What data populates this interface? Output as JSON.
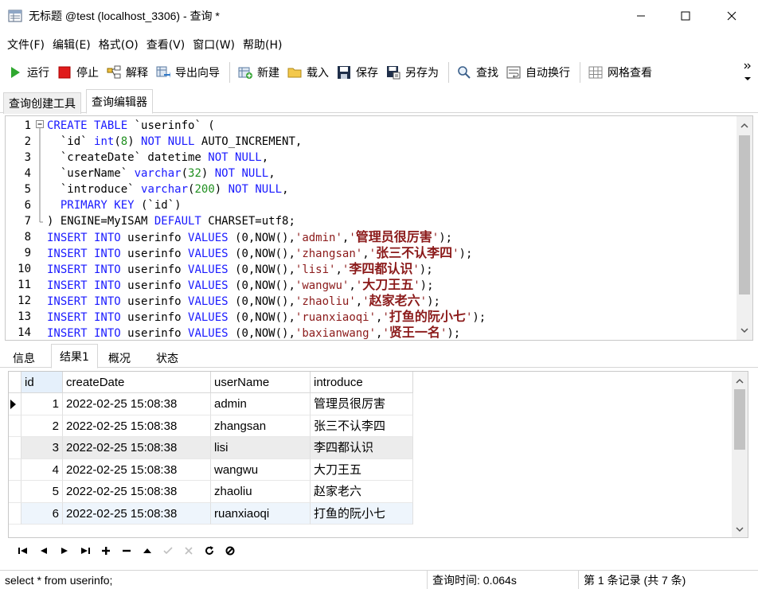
{
  "window": {
    "title": "无标题 @test (localhost_3306) - 查询 *"
  },
  "menu": [
    "文件(F)",
    "编辑(E)",
    "格式(O)",
    "查看(V)",
    "窗口(W)",
    "帮助(H)"
  ],
  "toolbar": {
    "run": "运行",
    "stop": "停止",
    "explain": "解释",
    "export_wizard": "导出向导",
    "new": "新建",
    "load": "载入",
    "save": "保存",
    "save_as": "另存为",
    "find": "查找",
    "word_wrap": "自动换行",
    "grid_view": "网格查看"
  },
  "editor_tabs": {
    "builder": "查询创建工具",
    "editor": "查询编辑器"
  },
  "code": {
    "line_numbers": [
      "1",
      "2",
      "3",
      "4",
      "5",
      "6",
      "7",
      "8",
      "9",
      "10",
      "11",
      "12",
      "13",
      "14"
    ],
    "lines": [
      [
        [
          "kw",
          "CREATE TABLE"
        ],
        [
          "pl",
          " `userinfo` ("
        ]
      ],
      [
        [
          "pl",
          "  `id` "
        ],
        [
          "kw",
          "int"
        ],
        [
          "pl",
          "("
        ],
        [
          "num",
          "8"
        ],
        [
          "pl",
          ") "
        ],
        [
          "kw",
          "NOT NULL"
        ],
        [
          "pl",
          " AUTO_INCREMENT,"
        ]
      ],
      [
        [
          "pl",
          "  `createDate` datetime "
        ],
        [
          "kw",
          "NOT NULL"
        ],
        [
          "pl",
          ","
        ]
      ],
      [
        [
          "pl",
          "  `userName` "
        ],
        [
          "kw",
          "varchar"
        ],
        [
          "pl",
          "("
        ],
        [
          "num",
          "32"
        ],
        [
          "pl",
          ") "
        ],
        [
          "kw",
          "NOT NULL"
        ],
        [
          "pl",
          ","
        ]
      ],
      [
        [
          "pl",
          "  `introduce` "
        ],
        [
          "kw",
          "varchar"
        ],
        [
          "pl",
          "("
        ],
        [
          "num",
          "200"
        ],
        [
          "pl",
          ") "
        ],
        [
          "kw",
          "NOT NULL"
        ],
        [
          "pl",
          ","
        ]
      ],
      [
        [
          "pl",
          "  "
        ],
        [
          "kw",
          "PRIMARY KEY"
        ],
        [
          "pl",
          " (`id`)"
        ]
      ],
      [
        [
          "pl",
          ") ENGINE=MyISAM "
        ],
        [
          "kw",
          "DEFAULT"
        ],
        [
          "pl",
          " CHARSET=utf8;"
        ]
      ],
      [
        [
          "kw",
          "INSERT INTO"
        ],
        [
          "pl",
          " userinfo "
        ],
        [
          "kw",
          "VALUES"
        ],
        [
          "pl",
          " (0,NOW(),"
        ],
        [
          "str",
          "'admin'"
        ],
        [
          "pl",
          ","
        ],
        [
          "str",
          "'"
        ],
        [
          "cn",
          "管理员很厉害"
        ],
        [
          "str",
          "'"
        ],
        [
          "pl",
          ");"
        ]
      ],
      [
        [
          "kw",
          "INSERT INTO"
        ],
        [
          "pl",
          " userinfo "
        ],
        [
          "kw",
          "VALUES"
        ],
        [
          "pl",
          " (0,NOW(),"
        ],
        [
          "str",
          "'zhangsan'"
        ],
        [
          "pl",
          ","
        ],
        [
          "str",
          "'"
        ],
        [
          "cn",
          "张三不认李四"
        ],
        [
          "str",
          "'"
        ],
        [
          "pl",
          ");"
        ]
      ],
      [
        [
          "kw",
          "INSERT INTO"
        ],
        [
          "pl",
          " userinfo "
        ],
        [
          "kw",
          "VALUES"
        ],
        [
          "pl",
          " (0,NOW(),"
        ],
        [
          "str",
          "'lisi'"
        ],
        [
          "pl",
          ","
        ],
        [
          "str",
          "'"
        ],
        [
          "cn",
          "李四都认识"
        ],
        [
          "str",
          "'"
        ],
        [
          "pl",
          ");"
        ]
      ],
      [
        [
          "kw",
          "INSERT INTO"
        ],
        [
          "pl",
          " userinfo "
        ],
        [
          "kw",
          "VALUES"
        ],
        [
          "pl",
          " (0,NOW(),"
        ],
        [
          "str",
          "'wangwu'"
        ],
        [
          "pl",
          ","
        ],
        [
          "str",
          "'"
        ],
        [
          "cn",
          "大刀王五"
        ],
        [
          "str",
          "'"
        ],
        [
          "pl",
          ");"
        ]
      ],
      [
        [
          "kw",
          "INSERT INTO"
        ],
        [
          "pl",
          " userinfo "
        ],
        [
          "kw",
          "VALUES"
        ],
        [
          "pl",
          " (0,NOW(),"
        ],
        [
          "str",
          "'zhaoliu'"
        ],
        [
          "pl",
          ","
        ],
        [
          "str",
          "'"
        ],
        [
          "cn",
          "赵家老六"
        ],
        [
          "str",
          "'"
        ],
        [
          "pl",
          ");"
        ]
      ],
      [
        [
          "kw",
          "INSERT INTO"
        ],
        [
          "pl",
          " userinfo "
        ],
        [
          "kw",
          "VALUES"
        ],
        [
          "pl",
          " (0,NOW(),"
        ],
        [
          "str",
          "'ruanxiaoqi'"
        ],
        [
          "pl",
          ","
        ],
        [
          "str",
          "'"
        ],
        [
          "cn",
          "打鱼的阮小七"
        ],
        [
          "str",
          "'"
        ],
        [
          "pl",
          ");"
        ]
      ],
      [
        [
          "kw",
          "INSERT INTO"
        ],
        [
          "pl",
          " userinfo "
        ],
        [
          "kw",
          "VALUES"
        ],
        [
          "pl",
          " (0,NOW(),"
        ],
        [
          "str",
          "'baxianwang'"
        ],
        [
          "pl",
          ","
        ],
        [
          "str",
          "'"
        ],
        [
          "cn",
          "贤王一名"
        ],
        [
          "str",
          "'"
        ],
        [
          "pl",
          ");"
        ]
      ]
    ]
  },
  "result_tabs": [
    "信息",
    "结果1",
    "概况",
    "状态"
  ],
  "grid": {
    "columns": [
      "id",
      "createDate",
      "userName",
      "introduce"
    ],
    "rows": [
      [
        "1",
        "2022-02-25 15:08:38",
        "admin",
        "管理员很厉害"
      ],
      [
        "2",
        "2022-02-25 15:08:38",
        "zhangsan",
        "张三不认李四"
      ],
      [
        "3",
        "2022-02-25 15:08:38",
        "lisi",
        "李四都认识"
      ],
      [
        "4",
        "2022-02-25 15:08:38",
        "wangwu",
        "大刀王五"
      ],
      [
        "5",
        "2022-02-25 15:08:38",
        "zhaoliu",
        "赵家老六"
      ],
      [
        "6",
        "2022-02-25 15:08:38",
        "ruanxiaoqi",
        "打鱼的阮小七"
      ]
    ]
  },
  "status": {
    "sql": "select * from userinfo;",
    "query_time": "查询时间: 0.064s",
    "record": "第 1 条记录 (共 7 条)"
  },
  "colors": {
    "keyword": "#1a1aff",
    "number": "#209020",
    "string": "#8b1a1a"
  }
}
